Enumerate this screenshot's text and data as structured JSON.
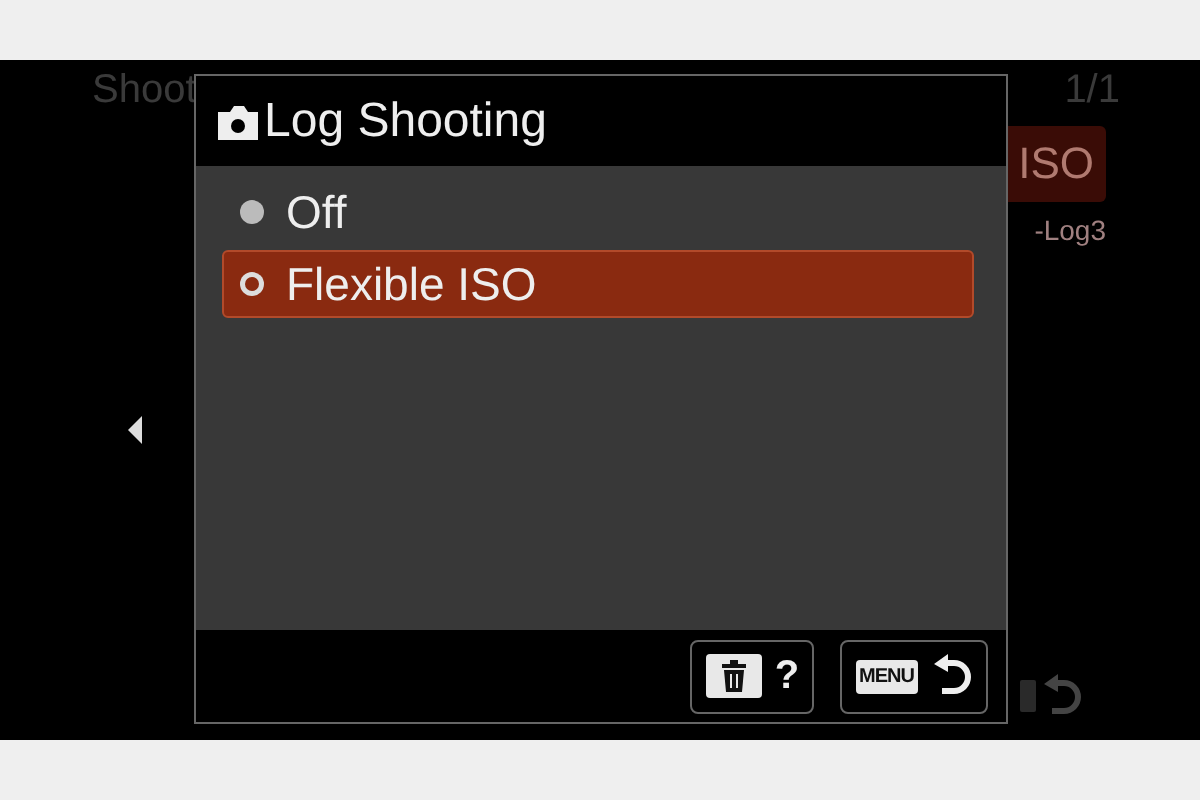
{
  "background_menu": {
    "title": "Shoot",
    "page": "1/1",
    "setting": {
      "label": "ISO",
      "selected": true
    },
    "value": "-Log3"
  },
  "dialog": {
    "title": "Log Shooting",
    "options": [
      {
        "label": "Off",
        "selected": false
      },
      {
        "label": "Flexible ISO",
        "selected": true
      }
    ],
    "footer_buttons": [
      {
        "kind": "delete-help",
        "label": "?"
      },
      {
        "kind": "menu-back",
        "label": "MENU"
      }
    ]
  }
}
